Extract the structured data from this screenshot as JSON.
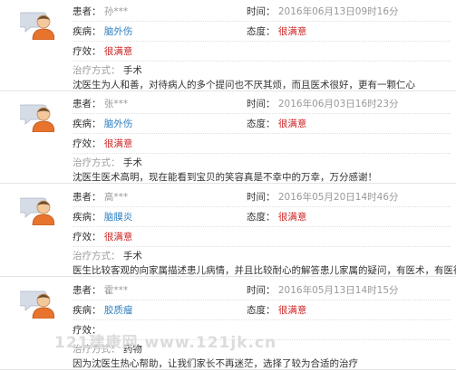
{
  "labels": {
    "patient": "患者：",
    "disease": "疾病：",
    "efficacy": "疗效：",
    "time": "时间：",
    "attitude": "态度：",
    "treatment": "治疗方式："
  },
  "colors": {
    "disease_link": "#2e7fc1",
    "rating": "#cc2222",
    "muted": "#9c9c9c"
  },
  "reviews": [
    {
      "patient": "孙***",
      "time": "2016年06月13日09时16分",
      "disease": "脑外伤",
      "attitude": "很满意",
      "efficacy": "很满意",
      "treatment": "手术",
      "comment": "沈医生为人和善，对待病人的多个提问也不厌其烦，而且医术很好，更有一颗仁心"
    },
    {
      "patient": "张***",
      "time": "2016年06月03日16时23分",
      "disease": "脑外伤",
      "attitude": "很满意",
      "efficacy": "很满意",
      "treatment": "手术",
      "comment": "沈医生医术高明，现在能看到宝贝的笑容真是不幸中的万幸，万分感谢！"
    },
    {
      "patient": "高***",
      "time": "2016年05月20日14时46分",
      "disease": "脑膜炎",
      "attitude": "很满意",
      "efficacy": "很满意",
      "treatment": "手术",
      "comment": "医生比较客观的向家属描述患儿病情，并且比较耐心的解答患儿家属的疑问，有医术，有医德。"
    },
    {
      "patient": "霍***",
      "time": "2016年05月13日14时15分",
      "disease": "胶质瘤",
      "attitude": "很满意",
      "efficacy": "",
      "treatment": "药物",
      "comment": "因为沈医生热心帮助，让我们家长不再迷茫，选择了较为合适的治疗"
    }
  ],
  "watermark": "121建康网    www.121jk.cn"
}
